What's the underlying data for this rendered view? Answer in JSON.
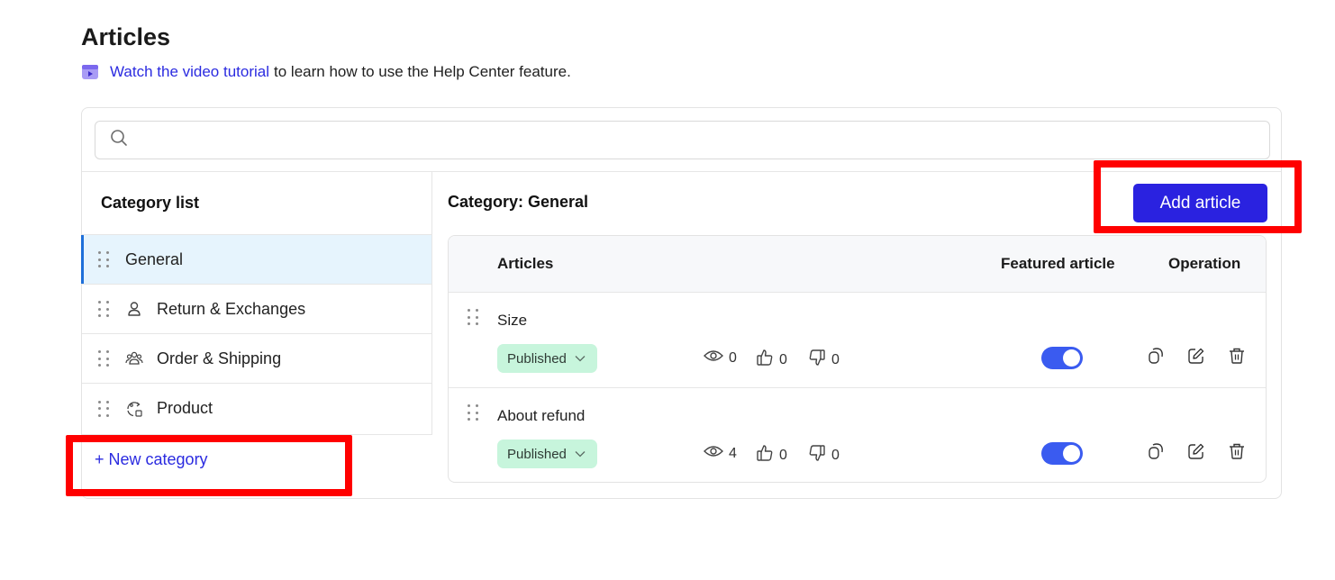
{
  "page": {
    "title": "Articles",
    "tutorial_link": "Watch the video tutorial",
    "tutorial_rest": "to learn how to use the Help Center feature."
  },
  "search": {
    "placeholder": ""
  },
  "sidebar": {
    "heading": "Category list",
    "items": [
      {
        "label": "General",
        "icon": "none",
        "active": true
      },
      {
        "label": "Return & Exchanges",
        "icon": "user-icon",
        "active": false
      },
      {
        "label": "Order & Shipping",
        "icon": "group-icon",
        "active": false
      },
      {
        "label": "Product",
        "icon": "product-refresh-icon",
        "active": false
      }
    ],
    "new_category": "+ New category"
  },
  "main": {
    "heading": "Category: General",
    "add_button": "Add article",
    "columns": {
      "articles": "Articles",
      "featured": "Featured article",
      "operation": "Operation"
    },
    "rows": [
      {
        "title": "Size",
        "status": "Published",
        "views": "0",
        "likes": "0",
        "dislikes": "0",
        "featured": true
      },
      {
        "title": "About refund",
        "status": "Published",
        "views": "4",
        "likes": "0",
        "dislikes": "0",
        "featured": true
      }
    ]
  },
  "colors": {
    "accent": "#2a22e0",
    "link": "#2b2be0",
    "toggle_on": "#3a5bf0",
    "status_bg": "#c7f5dc",
    "highlight": "#ff0000"
  }
}
